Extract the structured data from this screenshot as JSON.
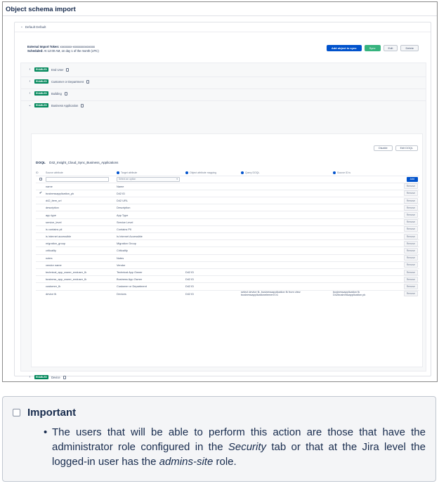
{
  "page": {
    "title": "Object schema import"
  },
  "panel": {
    "header": "Default Default",
    "external_import_label": "External Import Token:",
    "external_import_value": "xxxxxxxx-xxxxxxxxxxxxxxx",
    "scheduled_label": "Scheduled:",
    "scheduled_value": "At 12:00 AM, on day 1 of the month (UTC)",
    "buttons": {
      "add_object": "Add object to sync",
      "sync": "Sync",
      "edit": "Edit",
      "delete": "Delete"
    }
  },
  "object_types": [
    {
      "badge": "ENABLED",
      "name": "End User"
    },
    {
      "badge": "ENABLED",
      "name": "Customer or Department"
    },
    {
      "badge": "ENABLED",
      "name": "Building"
    },
    {
      "badge": "ENABLED",
      "name": "Business Application"
    }
  ],
  "detail": {
    "disable_label": "Disable",
    "edit_dql_label": "Edit DOQL",
    "dql_label": "DOQL",
    "dql_value": "D42_Insight_Cloud_Sync_Business_Applications",
    "columns": {
      "id": "ID",
      "source": "Source attribute",
      "target": "Target attribute",
      "mapping": "Object attribute mapping",
      "query": "Query DOQL",
      "source_id": "Source ID is",
      "add": "Add"
    },
    "select_placeholder": "Select an option",
    "remove_label": "Remove",
    "rows": [
      {
        "check": "",
        "source": "name",
        "target": "Name",
        "mapping": "",
        "query": "",
        "sid": ""
      },
      {
        "check": "✔",
        "source": "businessapplication_pk",
        "target": "D42 ID",
        "mapping": "",
        "query": "",
        "sid": ""
      },
      {
        "check": "",
        "source": "d42_item_url",
        "target": "D42 URL",
        "mapping": "",
        "query": "",
        "sid": ""
      },
      {
        "check": "",
        "source": "description",
        "target": "Description",
        "mapping": "",
        "query": "",
        "sid": ""
      },
      {
        "check": "",
        "source": "app type",
        "target": "App Type",
        "mapping": "",
        "query": "",
        "sid": ""
      },
      {
        "check": "",
        "source": "service_level",
        "target": "Service Level",
        "mapping": "",
        "query": "",
        "sid": ""
      },
      {
        "check": "",
        "source": "is contains pii",
        "target": "Contains PII",
        "mapping": "",
        "query": "",
        "sid": ""
      },
      {
        "check": "",
        "source": "is internet accessible",
        "target": "Is Internet Accessible",
        "mapping": "",
        "query": "",
        "sid": ""
      },
      {
        "check": "",
        "source": "migration_group",
        "target": "Migration Group",
        "mapping": "",
        "query": "",
        "sid": ""
      },
      {
        "check": "",
        "source": "criticality",
        "target": "Criticality",
        "mapping": "",
        "query": "",
        "sid": ""
      },
      {
        "check": "",
        "source": "notes",
        "target": "Notes",
        "mapping": "",
        "query": "",
        "sid": ""
      },
      {
        "check": "",
        "source": "vendor name",
        "target": "Vendor",
        "mapping": "",
        "query": "",
        "sid": ""
      },
      {
        "check": "",
        "source": "technical_app_owner_enduser_fk",
        "target": "Technical App Owner",
        "mapping": "D42 ID",
        "query": "",
        "sid": ""
      },
      {
        "check": "",
        "source": "business_app_owner_enduser_fk",
        "target": "Business App Owner",
        "mapping": "D42 ID",
        "query": "",
        "sid": ""
      },
      {
        "check": "",
        "source": "customer_fk",
        "target": "Customer or Department",
        "mapping": "D42 ID",
        "query": "",
        "sid": ""
      },
      {
        "check": "",
        "source": "device fk",
        "target": "Devices",
        "mapping": "D42 ID",
        "query": "select device fk, businessapplication fk from view businessapplicationelement v1",
        "sid": "businessapplication fk D42businessapplication pk"
      }
    ]
  },
  "device_row": {
    "badge": "ENABLED",
    "name": "Device"
  },
  "callout": {
    "title": "Important",
    "bullet": "•",
    "text_1": "The users that will be able to perform this action are those that have the administrator role configured in the ",
    "text_security": "Security",
    "text_2": " tab or that at the Jira level the logged-in user has the ",
    "text_admins": "admins-site",
    "text_3": " role."
  }
}
